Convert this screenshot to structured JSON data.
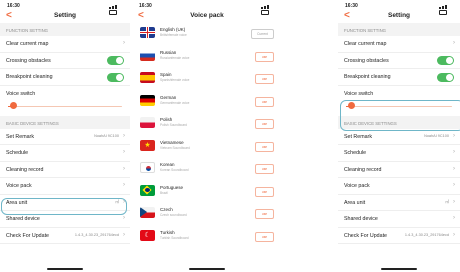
{
  "status_time": "16:30",
  "settings": {
    "title": "Setting",
    "back": "<",
    "section_function": "FUNCTION SETTING",
    "clear_map": "Clear current map",
    "crossing": "Crossing obstacles",
    "breakpoint": "Breakpoint cleaning",
    "voice_switch": "Voice switch",
    "voice_level": 0.05,
    "section_basic": "BASIC DEVICE SETTINGS",
    "set_remark": "Set Remark",
    "set_remark_value": "NoahAI 9C100",
    "schedule": "Schedule",
    "cleaning_record": "Cleaning record",
    "voice_pack": "Voice pack",
    "area_unit": "Area unit",
    "area_unit_value": "㎡",
    "shared_device": "Shared device",
    "check_update": "Check For Update",
    "check_update_value": "1.4.3_4.30.23_291764ecd",
    "colors": {
      "accent": "#f06a3f",
      "toggle": "#4cba5f",
      "highlight": "#6fb6c8"
    }
  },
  "voice_pack": {
    "title": "Voice pack",
    "back": "<",
    "items": [
      {
        "name": "English (UK)",
        "desc": "Britishfemale voice",
        "button": "Current"
      },
      {
        "name": "Russian",
        "desc": "Russianfemale voice",
        "button": "use"
      },
      {
        "name": "Spain",
        "desc": "Spanishfemale voice",
        "button": "use"
      },
      {
        "name": "German",
        "desc": "Germanfemale voice",
        "button": "use"
      },
      {
        "name": "Polish",
        "desc": "Polish Soundboard",
        "button": "use"
      },
      {
        "name": "Vietnamese",
        "desc": "Vietnam Soundboard",
        "button": "use"
      },
      {
        "name": "Korean",
        "desc": "Korean Soundboard",
        "button": "use"
      },
      {
        "name": "Portuguese",
        "desc": "Brazil",
        "button": "use"
      },
      {
        "name": "Czech",
        "desc": "Czech soundboard",
        "button": "use"
      },
      {
        "name": "Turkish",
        "desc": "Turkish Soundboard",
        "button": "use"
      }
    ]
  }
}
